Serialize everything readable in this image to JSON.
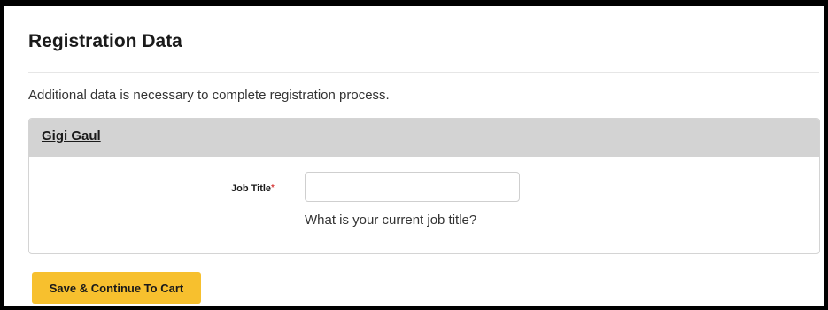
{
  "page": {
    "title": "Registration Data",
    "intro": "Additional data is necessary to complete registration process."
  },
  "attendee": {
    "name": "Gigi Gaul"
  },
  "job_title_field": {
    "label": "Job Title",
    "required_marker": "*",
    "value": "",
    "placeholder": "",
    "help": "What is your current job title?"
  },
  "actions": {
    "submit_label": "Save & Continue To Cart"
  },
  "colors": {
    "accent_button": "#f7c02e",
    "card_header": "#d3d3d3",
    "required": "#cc0000"
  }
}
